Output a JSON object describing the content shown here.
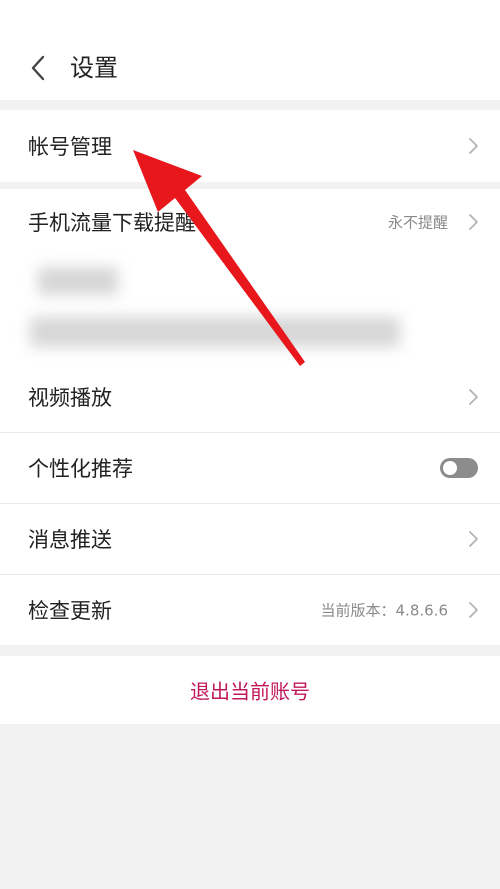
{
  "header": {
    "title": "设置",
    "back_icon": "chevron-left-icon"
  },
  "settings": {
    "account_management": "帐号管理",
    "mobile_data_download_reminder": {
      "label": "手机流量下载提醒",
      "value": "永不提醒"
    },
    "video_playback": "视频播放",
    "personalized_recommendation": {
      "label": "个性化推荐",
      "enabled": false
    },
    "message_push": "消息推送",
    "check_update": {
      "label": "检查更新",
      "value": "当前版本：4.8.6.6"
    }
  },
  "logout": {
    "label": "退出当前账号"
  },
  "colors": {
    "accent": "#c2185b",
    "annotation_arrow": "#e8171c",
    "background": "#f2f2f2"
  }
}
